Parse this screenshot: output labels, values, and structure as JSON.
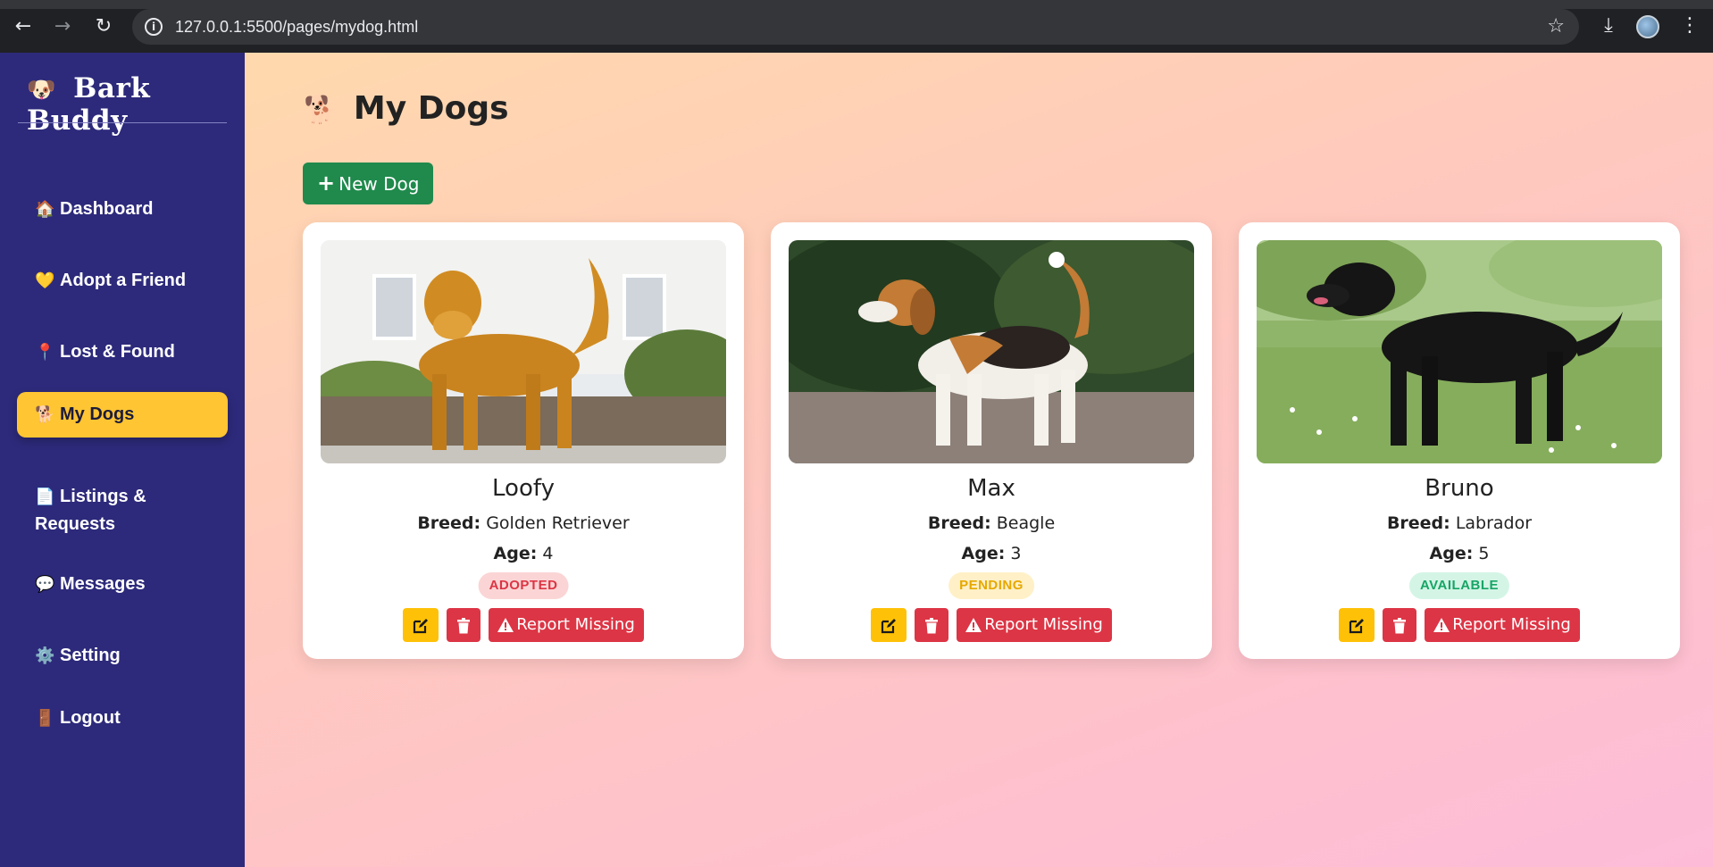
{
  "browser": {
    "url": "127.0.0.1:5500/pages/mydog.html"
  },
  "sidebar": {
    "brand": "Bark Buddy",
    "brand_emoji": "🐶",
    "items": [
      {
        "emoji": "🏠",
        "label": "Dashboard"
      },
      {
        "emoji": "💛",
        "label": "Adopt a Friend"
      },
      {
        "emoji": "📍",
        "label": "Lost & Found"
      },
      {
        "emoji": "🐕",
        "label": "My Dogs",
        "active": true
      },
      {
        "emoji": "📄",
        "label": "Listings & Requests"
      },
      {
        "emoji": "💬",
        "label": "Messages"
      },
      {
        "emoji": "⚙️",
        "label": "Setting"
      },
      {
        "emoji": "🚪",
        "label": "Logout"
      }
    ]
  },
  "main": {
    "title": "My Dogs",
    "title_emoji": "🐕",
    "new_button": "New Dog",
    "breed_label": "Breed:",
    "age_label": "Age:",
    "report_label": "Report Missing",
    "dogs": [
      {
        "name": "Loofy",
        "breed": "Golden Retriever",
        "age": "4",
        "status": "ADOPTED",
        "image": "golden-retriever-photo"
      },
      {
        "name": "Max",
        "breed": "Beagle",
        "age": "3",
        "status": "PENDING",
        "image": "beagle-photo"
      },
      {
        "name": "Bruno",
        "breed": "Labrador",
        "age": "5",
        "status": "AVAILABLE",
        "image": "black-labrador-photo"
      }
    ]
  },
  "colors": {
    "sidebar_bg": "#2d2a7b",
    "active_item": "#ffc533",
    "new_button": "#1f8a4c",
    "danger": "#dc3545",
    "warning": "#ffc107"
  }
}
